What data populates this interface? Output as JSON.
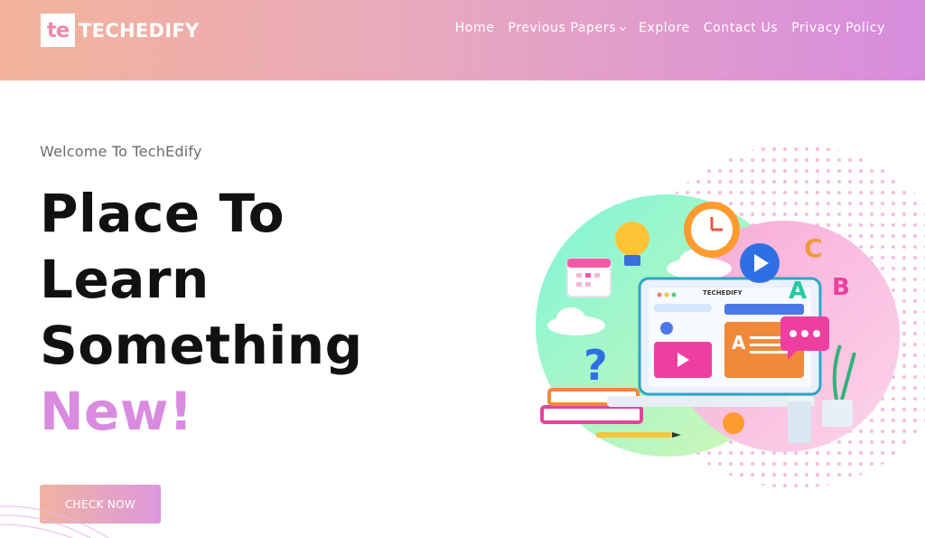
{
  "brand": {
    "badge": "te",
    "name": "TECHEDIFY"
  },
  "nav": {
    "items": [
      {
        "label": "Home"
      },
      {
        "label": "Previous Papers",
        "has_dropdown": true
      },
      {
        "label": "Explore"
      },
      {
        "label": "Contact Us"
      },
      {
        "label": "Privacy Policy"
      }
    ]
  },
  "hero": {
    "welcome": "Welcome To TechEdify",
    "headline_lines": [
      "Place To",
      "Learn",
      "Something"
    ],
    "headline_accent": "New!",
    "cta_label": "CHECK NOW"
  },
  "illustration": {
    "screen_label": "TECHEDIFY",
    "letters": [
      "C",
      "A",
      "B"
    ],
    "icons": [
      "lightbulb-icon",
      "clock-icon",
      "play-icon",
      "calendar-icon",
      "question-mark-icon",
      "chat-bubble-icon",
      "user-icon",
      "pencil-icon",
      "plant-icon",
      "cup-icon",
      "books-icon",
      "cloud-icon"
    ]
  },
  "colors": {
    "header_gradient_start": "#f2b39a",
    "header_gradient_end": "#d88cde",
    "accent": "#d98be0",
    "headline": "#111111"
  }
}
